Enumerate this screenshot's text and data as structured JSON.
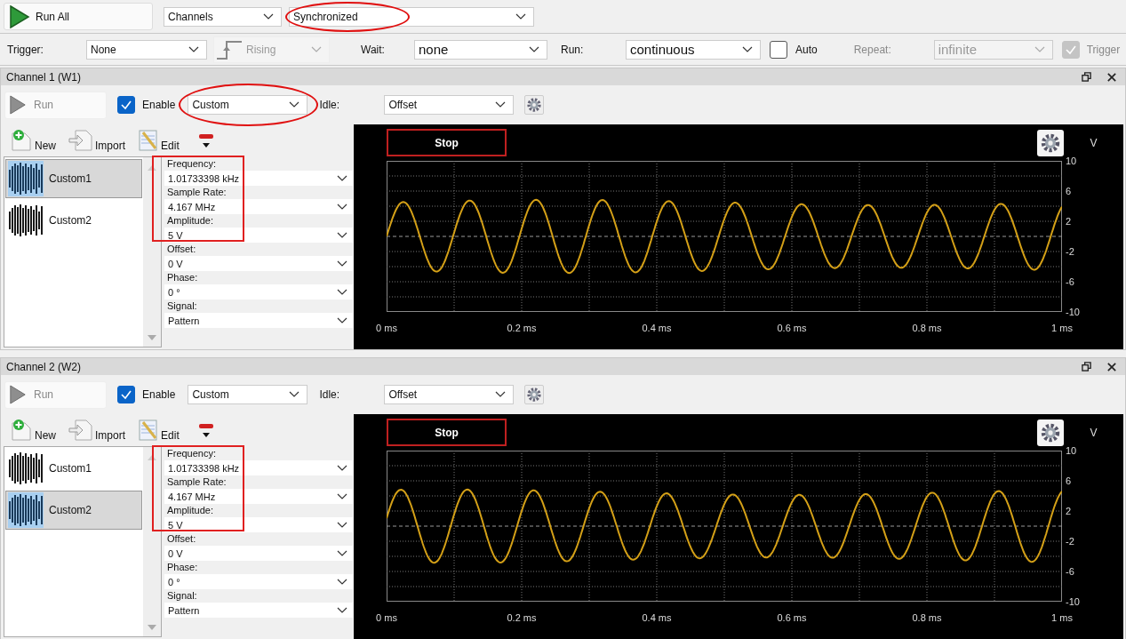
{
  "toolbar": {
    "run_all": "Run All",
    "channels": {
      "value": "Channels"
    },
    "mode": {
      "value": "Synchronized",
      "highlighted": true
    }
  },
  "trigger_bar": {
    "trigger_label": "Trigger:",
    "trigger": {
      "value": "None"
    },
    "edge": {
      "value": "Rising",
      "disabled": true
    },
    "wait_label": "Wait:",
    "wait": {
      "value": "none"
    },
    "run_label": "Run:",
    "run": {
      "value": "continuous"
    },
    "auto": {
      "label": "Auto",
      "checked": false
    },
    "repeat_label": "Repeat:",
    "repeat": {
      "value": "infinite",
      "disabled": true
    },
    "trigger_check": {
      "label": "Trigger",
      "checked": true,
      "disabled": true
    }
  },
  "channels": [
    {
      "title": "Channel 1 (W1)",
      "run": {
        "label": "Run",
        "disabled": true
      },
      "enable": {
        "label": "Enable",
        "checked": true
      },
      "type": {
        "value": "Custom",
        "highlighted": true
      },
      "idle_label": "Idle:",
      "idle": {
        "value": "Offset"
      },
      "tools": [
        {
          "kind": "new",
          "label": "New"
        },
        {
          "kind": "import",
          "label": "Import"
        },
        {
          "kind": "edit",
          "label": "Edit"
        },
        {
          "kind": "remove"
        }
      ],
      "patterns": [
        {
          "name": "Custom1",
          "selected": true
        },
        {
          "name": "Custom2",
          "selected": false
        }
      ],
      "params": [
        {
          "label": "Frequency:",
          "value": "1.01733398 kHz",
          "highlighted": true
        },
        {
          "label": "Sample Rate:",
          "value": "4.167 MHz",
          "highlighted": true
        },
        {
          "label": "Amplitude:",
          "value": "5 V",
          "highlighted": true
        },
        {
          "label": "Offset:",
          "value": "0 V",
          "highlighted": false
        },
        {
          "label": "Phase:",
          "value": "0 °",
          "highlighted": false
        },
        {
          "label": "Signal:",
          "value": "Pattern",
          "highlighted": false
        }
      ],
      "plot": {
        "stop": {
          "label": "Stop",
          "highlighted": true
        },
        "unit": "V",
        "y_ticks": [
          "10",
          "6",
          "2",
          "-2",
          "-6",
          "-10"
        ],
        "x_ticks": [
          "0 ms",
          "0.2 ms",
          "0.4 ms",
          "0.6 ms",
          "0.8 ms",
          "1 ms"
        ]
      }
    },
    {
      "title": "Channel 2 (W2)",
      "run": {
        "label": "Run",
        "disabled": true
      },
      "enable": {
        "label": "Enable",
        "checked": true
      },
      "type": {
        "value": "Custom",
        "highlighted": false
      },
      "idle_label": "Idle:",
      "idle": {
        "value": "Offset"
      },
      "tools": [
        {
          "kind": "new",
          "label": "New"
        },
        {
          "kind": "import",
          "label": "Import"
        },
        {
          "kind": "edit",
          "label": "Edit"
        },
        {
          "kind": "remove"
        }
      ],
      "patterns": [
        {
          "name": "Custom1",
          "selected": false
        },
        {
          "name": "Custom2",
          "selected": true
        }
      ],
      "params": [
        {
          "label": "Frequency:",
          "value": "1.01733398 kHz",
          "highlighted": true
        },
        {
          "label": "Sample Rate:",
          "value": "4.167 MHz",
          "highlighted": true
        },
        {
          "label": "Amplitude:",
          "value": "5 V",
          "highlighted": true
        },
        {
          "label": "Offset:",
          "value": "0 V",
          "highlighted": false
        },
        {
          "label": "Phase:",
          "value": "0 °",
          "highlighted": false
        },
        {
          "label": "Signal:",
          "value": "Pattern",
          "highlighted": false
        }
      ],
      "plot": {
        "stop": {
          "label": "Stop",
          "highlighted": true
        },
        "unit": "V",
        "y_ticks": [
          "10",
          "6",
          "2",
          "-2",
          "-6",
          "-10"
        ],
        "x_ticks": [
          "0 ms",
          "0.2 ms",
          "0.4 ms",
          "0.6 ms",
          "0.8 ms",
          "1 ms"
        ]
      }
    }
  ]
}
